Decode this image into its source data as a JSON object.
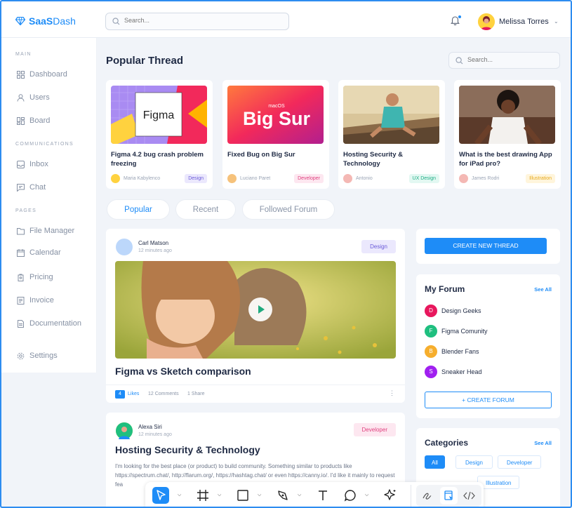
{
  "brand": {
    "name_bold": "SaaS",
    "name_light": "Dash",
    "logo_icon": "diamond-icon"
  },
  "topbar": {
    "search_placeholder": "Search...",
    "username": "Melissa Torres"
  },
  "sidebar": {
    "sections": [
      "MAIN",
      "COMMUNICATIONS",
      "PAGES"
    ],
    "items": [
      {
        "label": "Dashboard",
        "icon": "dashboard-icon"
      },
      {
        "label": "Users",
        "icon": "user-icon"
      },
      {
        "label": "Board",
        "icon": "board-icon"
      },
      {
        "label": "Inbox",
        "icon": "inbox-icon"
      },
      {
        "label": "Chat",
        "icon": "chat-icon"
      },
      {
        "label": "File Manager",
        "icon": "folder-icon"
      },
      {
        "label": "Calendar",
        "icon": "calendar-icon"
      },
      {
        "label": "Pricing",
        "icon": "price-tag-icon"
      },
      {
        "label": "Invoice",
        "icon": "invoice-icon"
      },
      {
        "label": "Documentation",
        "icon": "document-icon"
      },
      {
        "label": "Settings",
        "icon": "gear-icon"
      }
    ]
  },
  "main": {
    "title": "Popular Thread",
    "search_placeholder": "Search...",
    "threads": [
      {
        "img_text": "Figma",
        "title": "Figma 4.2 bug crash problem freezing",
        "author": "Maria Kabylenco",
        "tag": "Design"
      },
      {
        "img_text_small": "macOS",
        "img_text": "Big Sur",
        "title": "Fixed Bug on Big Sur",
        "author": "Luciano Paret",
        "tag": "Developer"
      },
      {
        "title": "Hosting Security & Technology",
        "author": "Antonio",
        "tag": "UX Design"
      },
      {
        "title": "What is the best drawing App for iPad pro?",
        "author": "James Rodri",
        "tag": "Illustration"
      }
    ],
    "tabs": [
      "Popular",
      "Recent",
      "Followed Forum"
    ],
    "posts": [
      {
        "author": "Carl Matson",
        "time": "12 minutes ago",
        "tag": "Design",
        "title": "Figma vs Sketch comparison",
        "likes_count": "4",
        "likes_label": "Likes",
        "comments": "12 Comments",
        "shares": "1 Share"
      },
      {
        "author": "Alexa Siri",
        "time": "12 minutes ago",
        "tag": "Developer",
        "title": "Hosting Security & Technology",
        "body": "I'm looking for the best place (or product) to build community. Something similar to products like https://spectrum.chat/, http://flarum.org/, https://hashtag.chat/ or even https://canny.io/. I'd like it mainly to request fea"
      }
    ]
  },
  "right": {
    "create_thread": "CREATE NEW THREAD",
    "my_forum": {
      "title": "My Forum",
      "see_all": "See All",
      "items": [
        {
          "letter": "D",
          "name": "Design Geeks",
          "color": "#e8175d"
        },
        {
          "letter": "F",
          "name": "Figma Comunity",
          "color": "#1fbf7f"
        },
        {
          "letter": "B",
          "name": "Blender Fans",
          "color": "#f6ae2d"
        },
        {
          "letter": "S",
          "name": "Sneaker Head",
          "color": "#a020f0"
        }
      ],
      "create_forum": "+ CREATE FORUM"
    },
    "categories": {
      "title": "Categories",
      "see_all": "See All",
      "items": [
        "All",
        "Design",
        "Developer",
        "Illustration"
      ]
    }
  },
  "colors": {
    "accent": "#1e8cf7",
    "frame": "#2d8cf0"
  }
}
